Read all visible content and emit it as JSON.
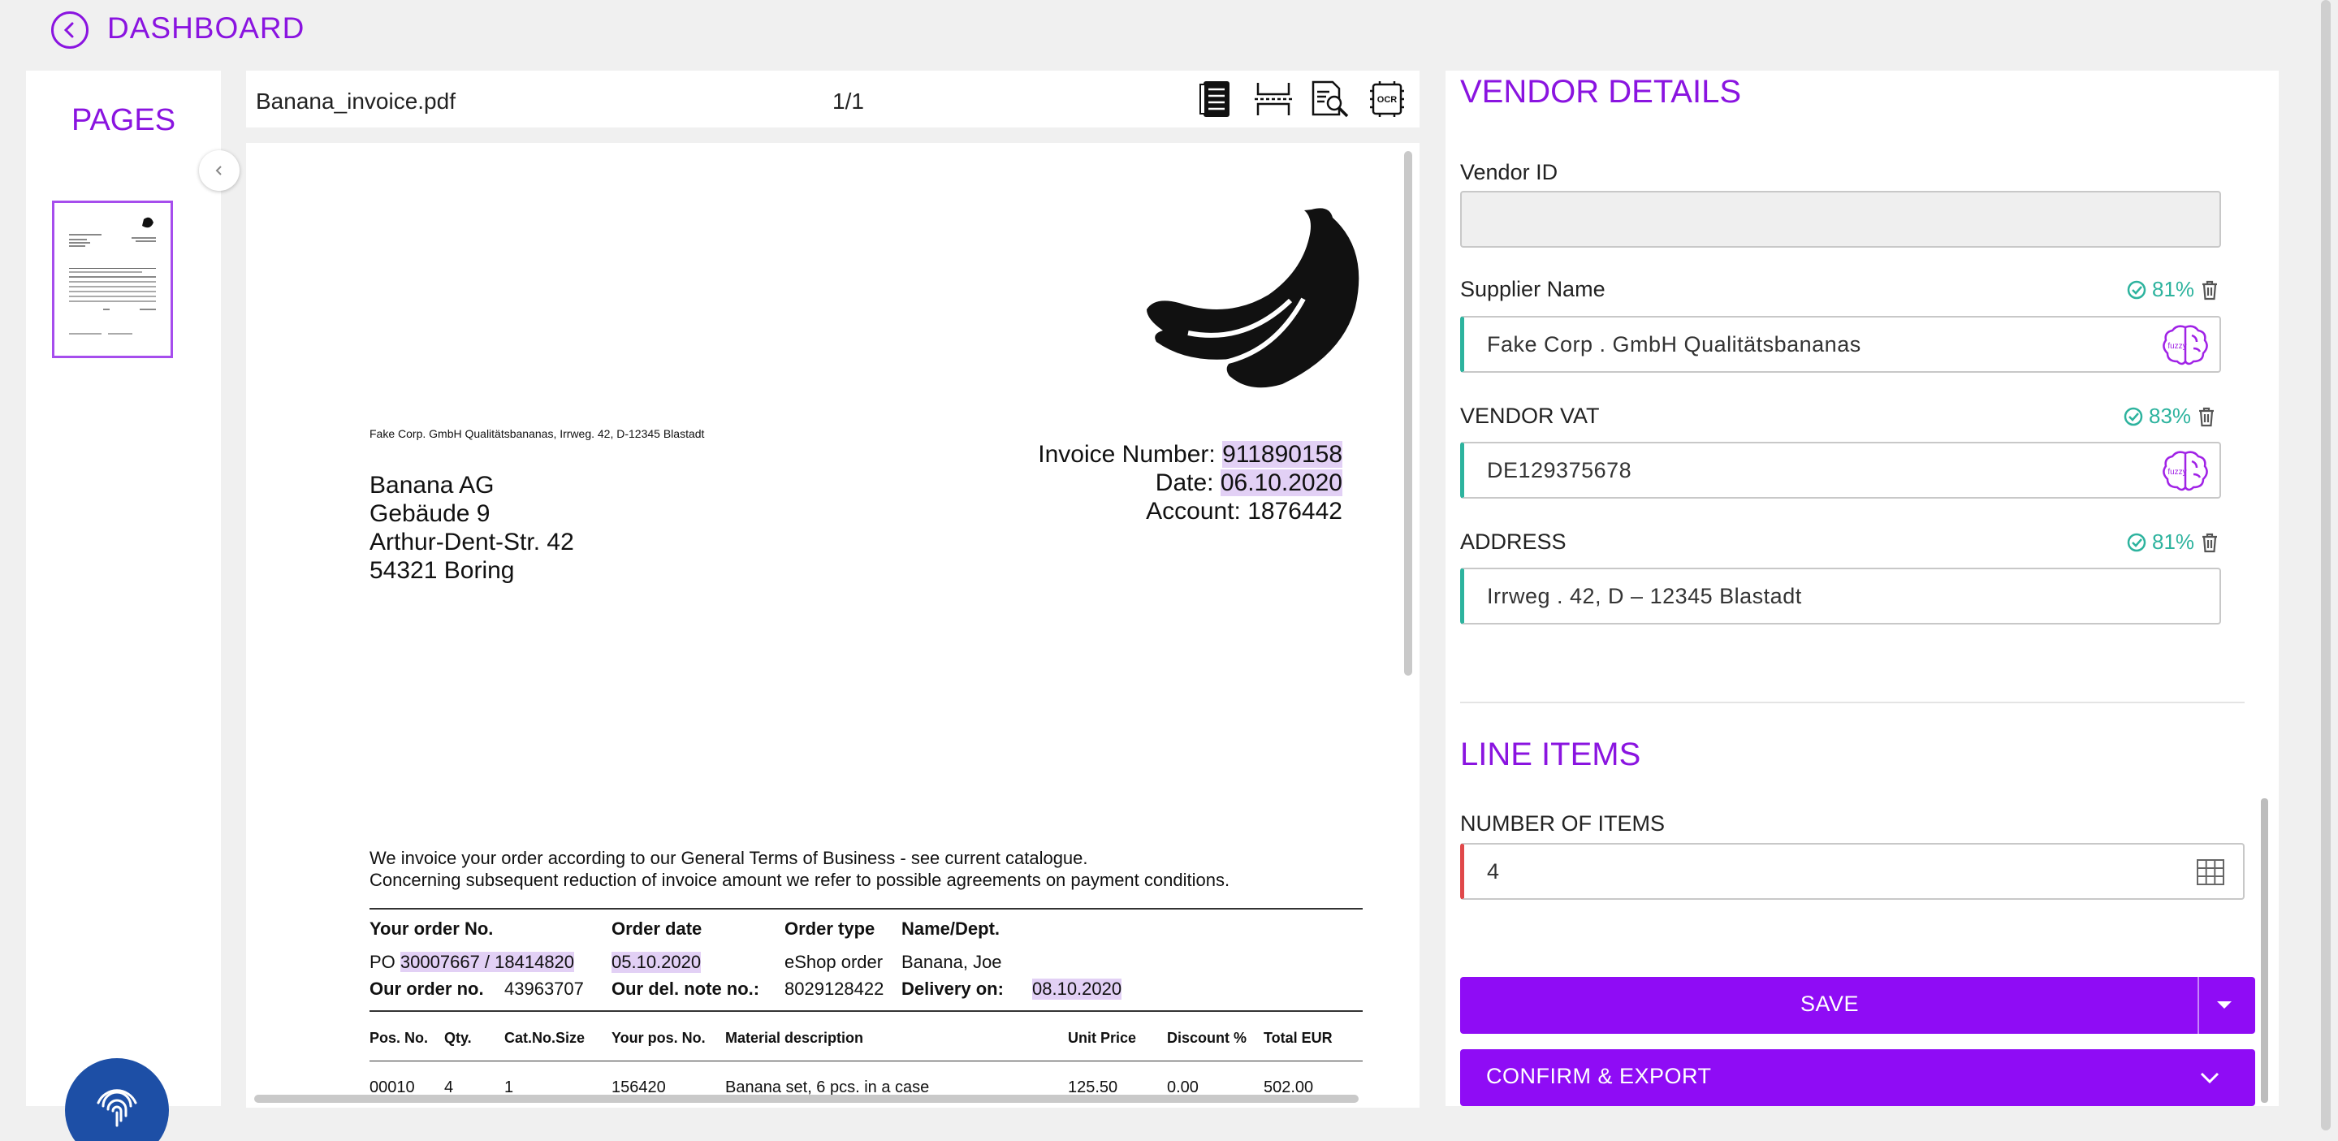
{
  "header": {
    "title": "DASHBOARD"
  },
  "pages_panel": {
    "title": "PAGES"
  },
  "viewer": {
    "file_name": "Banana_invoice.pdf",
    "page_count": "1/1"
  },
  "document": {
    "sender_line": "Fake Corp. GmbH Qualitätsbananas, Irrweg. 42, D-12345 Blastadt",
    "recipient": [
      "Banana AG",
      "Gebäude 9",
      "Arthur-Dent-Str. 42",
      "54321 Boring"
    ],
    "invoice_number_label": "Invoice Number:",
    "invoice_number": "911890158",
    "date_label": "Date:",
    "date": "06.10.2020",
    "account": "Account: 1876442",
    "terms_1": "We invoice your order according to our General Terms of Business - see current catalogue.",
    "terms_2": "Concerning subsequent reduction of invoice amount we refer to possible agreements on payment conditions.",
    "order_headers": {
      "order_no": "Your order No.",
      "order_date": "Order date",
      "order_type": "Order type",
      "name_dept": "Name/Dept."
    },
    "po_prefix": "PO",
    "po_number": "30007667 / 18414820",
    "order_date": "05.10.2020",
    "order_type": "eShop order",
    "name_dept": "Banana, Joe",
    "our_order_label": "Our order no.",
    "our_order_no": "43963707",
    "del_note_label": "Our del. note no.:",
    "del_note_no": "8029128422",
    "delivery_label": "Delivery on:",
    "delivery_date": "08.10.2020",
    "table_headers": [
      "Pos. No.",
      "Qty.",
      "Cat.No.Size",
      "Your pos. No.",
      "Material description",
      "Unit Price",
      "Discount %",
      "Total EUR"
    ],
    "table_row_1": [
      "00010",
      "4",
      "1",
      "156420",
      "Banana set, 6 pcs. in a case",
      "125.50",
      "0.00",
      "502.00"
    ]
  },
  "vendor": {
    "title": "VENDOR DETAILS",
    "vendor_id": {
      "label": "Vendor ID",
      "value": ""
    },
    "supplier_name": {
      "label": "Supplier Name",
      "confidence": "81%",
      "value": "Fake Corp . GmbH Qualitätsbananas"
    },
    "vendor_vat": {
      "label": "VENDOR VAT",
      "confidence": "83%",
      "value": "DE129375678"
    },
    "address": {
      "label": "ADDRESS",
      "confidence": "81%",
      "value": "Irrweg . 42, D – 12345 Blastadt"
    }
  },
  "line_items": {
    "title": "LINE ITEMS",
    "number_of_items_label": "NUMBER OF ITEMS",
    "number_of_items": "4"
  },
  "actions": {
    "save_label": "SAVE",
    "confirm_label": "CONFIRM & EXPORT"
  },
  "colors": {
    "accent": "#8f0cf5",
    "confidence": "#2db39e",
    "error": "#e0484a",
    "fingerprint_button": "#1d4fa6"
  }
}
